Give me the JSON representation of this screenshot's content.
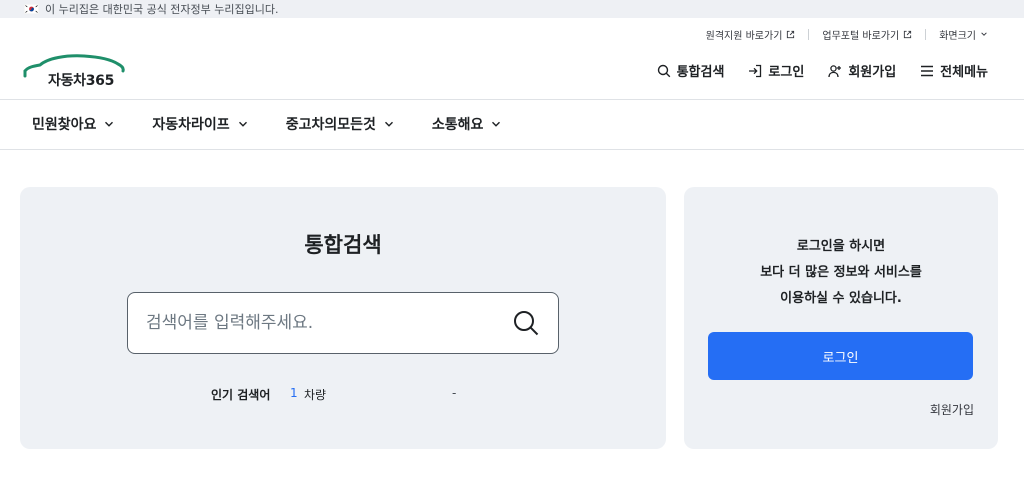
{
  "gov_banner": {
    "text": "이 누리집은 대한민국 공식 전자정부 누리집입니다."
  },
  "utility": {
    "remote_support": "원격지원 바로가기",
    "work_portal": "업무포털 바로가기",
    "screen_size": "화면크기"
  },
  "logo": {
    "text": "자동차365"
  },
  "header_actions": {
    "search": "통합검색",
    "login": "로그인",
    "signup": "회원가입",
    "menu": "전체메뉴"
  },
  "nav": {
    "items": [
      {
        "label": "민원찾아요"
      },
      {
        "label": "자동차라이프"
      },
      {
        "label": "중고차의모든것"
      },
      {
        "label": "소통해요"
      }
    ]
  },
  "search": {
    "title": "통합검색",
    "placeholder": "검색어를 입력해주세요.",
    "popular_label": "인기 검색어",
    "popular_rank": "1",
    "popular_word": "차량",
    "popular_dash": "-"
  },
  "login_card": {
    "line1": "로그인을 하시면",
    "line2": "보다 더 많은 정보와 서비스를",
    "line3": "이용하실 수 있습니다.",
    "login_button": "로그인",
    "signup_link": "회원가입"
  },
  "colors": {
    "primary": "#256ef4",
    "card_bg": "#eef1f5",
    "logo_green": "#1f8f6a"
  }
}
